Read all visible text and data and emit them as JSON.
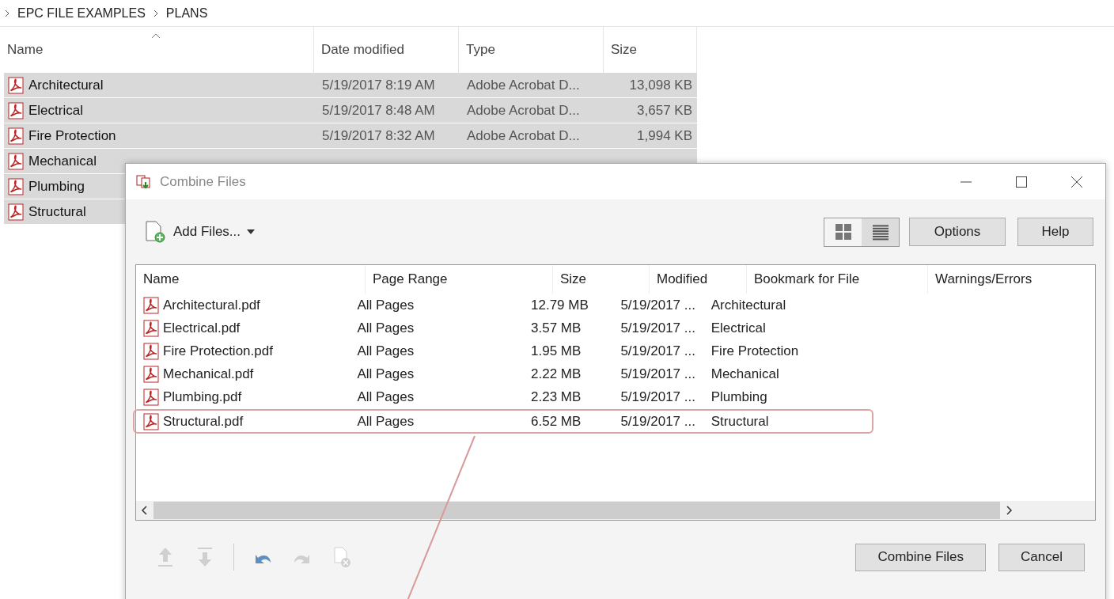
{
  "breadcrumb": [
    "EPC FILE EXAMPLES",
    "PLANS"
  ],
  "explorer": {
    "columns": [
      "Name",
      "Date modified",
      "Type",
      "Size"
    ],
    "rows": [
      {
        "name": "Architectural",
        "date": "5/19/2017 8:19 AM",
        "type": "Adobe Acrobat D...",
        "size": "13,098 KB",
        "selected": true
      },
      {
        "name": "Electrical",
        "date": "5/19/2017 8:48 AM",
        "type": "Adobe Acrobat D...",
        "size": "3,657 KB",
        "selected": true
      },
      {
        "name": "Fire Protection",
        "date": "5/19/2017 8:32 AM",
        "type": "Adobe Acrobat D...",
        "size": "1,994 KB",
        "selected": true
      },
      {
        "name": "Mechanical",
        "selected": true
      },
      {
        "name": "Plumbing",
        "selected": true
      },
      {
        "name": "Structural",
        "selected": true
      }
    ]
  },
  "dialog": {
    "title": "Combine Files",
    "add_files": "Add Files...",
    "views": [
      {
        "kind": "thumbnails",
        "selected": false
      },
      {
        "kind": "list",
        "selected": true
      }
    ],
    "buttons": [
      "Options",
      "Help"
    ],
    "columns": [
      "Name",
      "Page Range",
      "Size",
      "Modified",
      "Bookmark for File",
      "Warnings/Errors"
    ],
    "rows": [
      {
        "name": "Architectural.pdf",
        "range": "All Pages",
        "size": "12.79 MB",
        "modified": "5/19/2017 ...",
        "bookmark": "Architectural",
        "annotated": false
      },
      {
        "name": "Electrical.pdf",
        "range": "All Pages",
        "size": "3.57 MB",
        "modified": "5/19/2017 ...",
        "bookmark": "Electrical",
        "annotated": false
      },
      {
        "name": "Fire Protection.pdf",
        "range": "All Pages",
        "size": "1.95 MB",
        "modified": "5/19/2017 ...",
        "bookmark": "Fire Protection",
        "annotated": false
      },
      {
        "name": "Mechanical.pdf",
        "range": "All Pages",
        "size": "2.22 MB",
        "modified": "5/19/2017 ...",
        "bookmark": "Mechanical",
        "annotated": false
      },
      {
        "name": "Plumbing.pdf",
        "range": "All Pages",
        "size": "2.23 MB",
        "modified": "5/19/2017 ...",
        "bookmark": "Plumbing",
        "annotated": false
      },
      {
        "name": "Structural.pdf",
        "range": "All Pages",
        "size": "6.52 MB",
        "modified": "5/19/2017 ...",
        "bookmark": "Structural",
        "annotated": true
      }
    ],
    "tools": [
      {
        "kind": "move-up",
        "disabled": true
      },
      {
        "kind": "move-down",
        "disabled": true
      },
      {
        "kind": "undo",
        "disabled": false
      },
      {
        "kind": "redo",
        "disabled": true
      },
      {
        "kind": "remove",
        "disabled": true
      }
    ],
    "footer_buttons": [
      "Combine Files",
      "Cancel"
    ]
  }
}
